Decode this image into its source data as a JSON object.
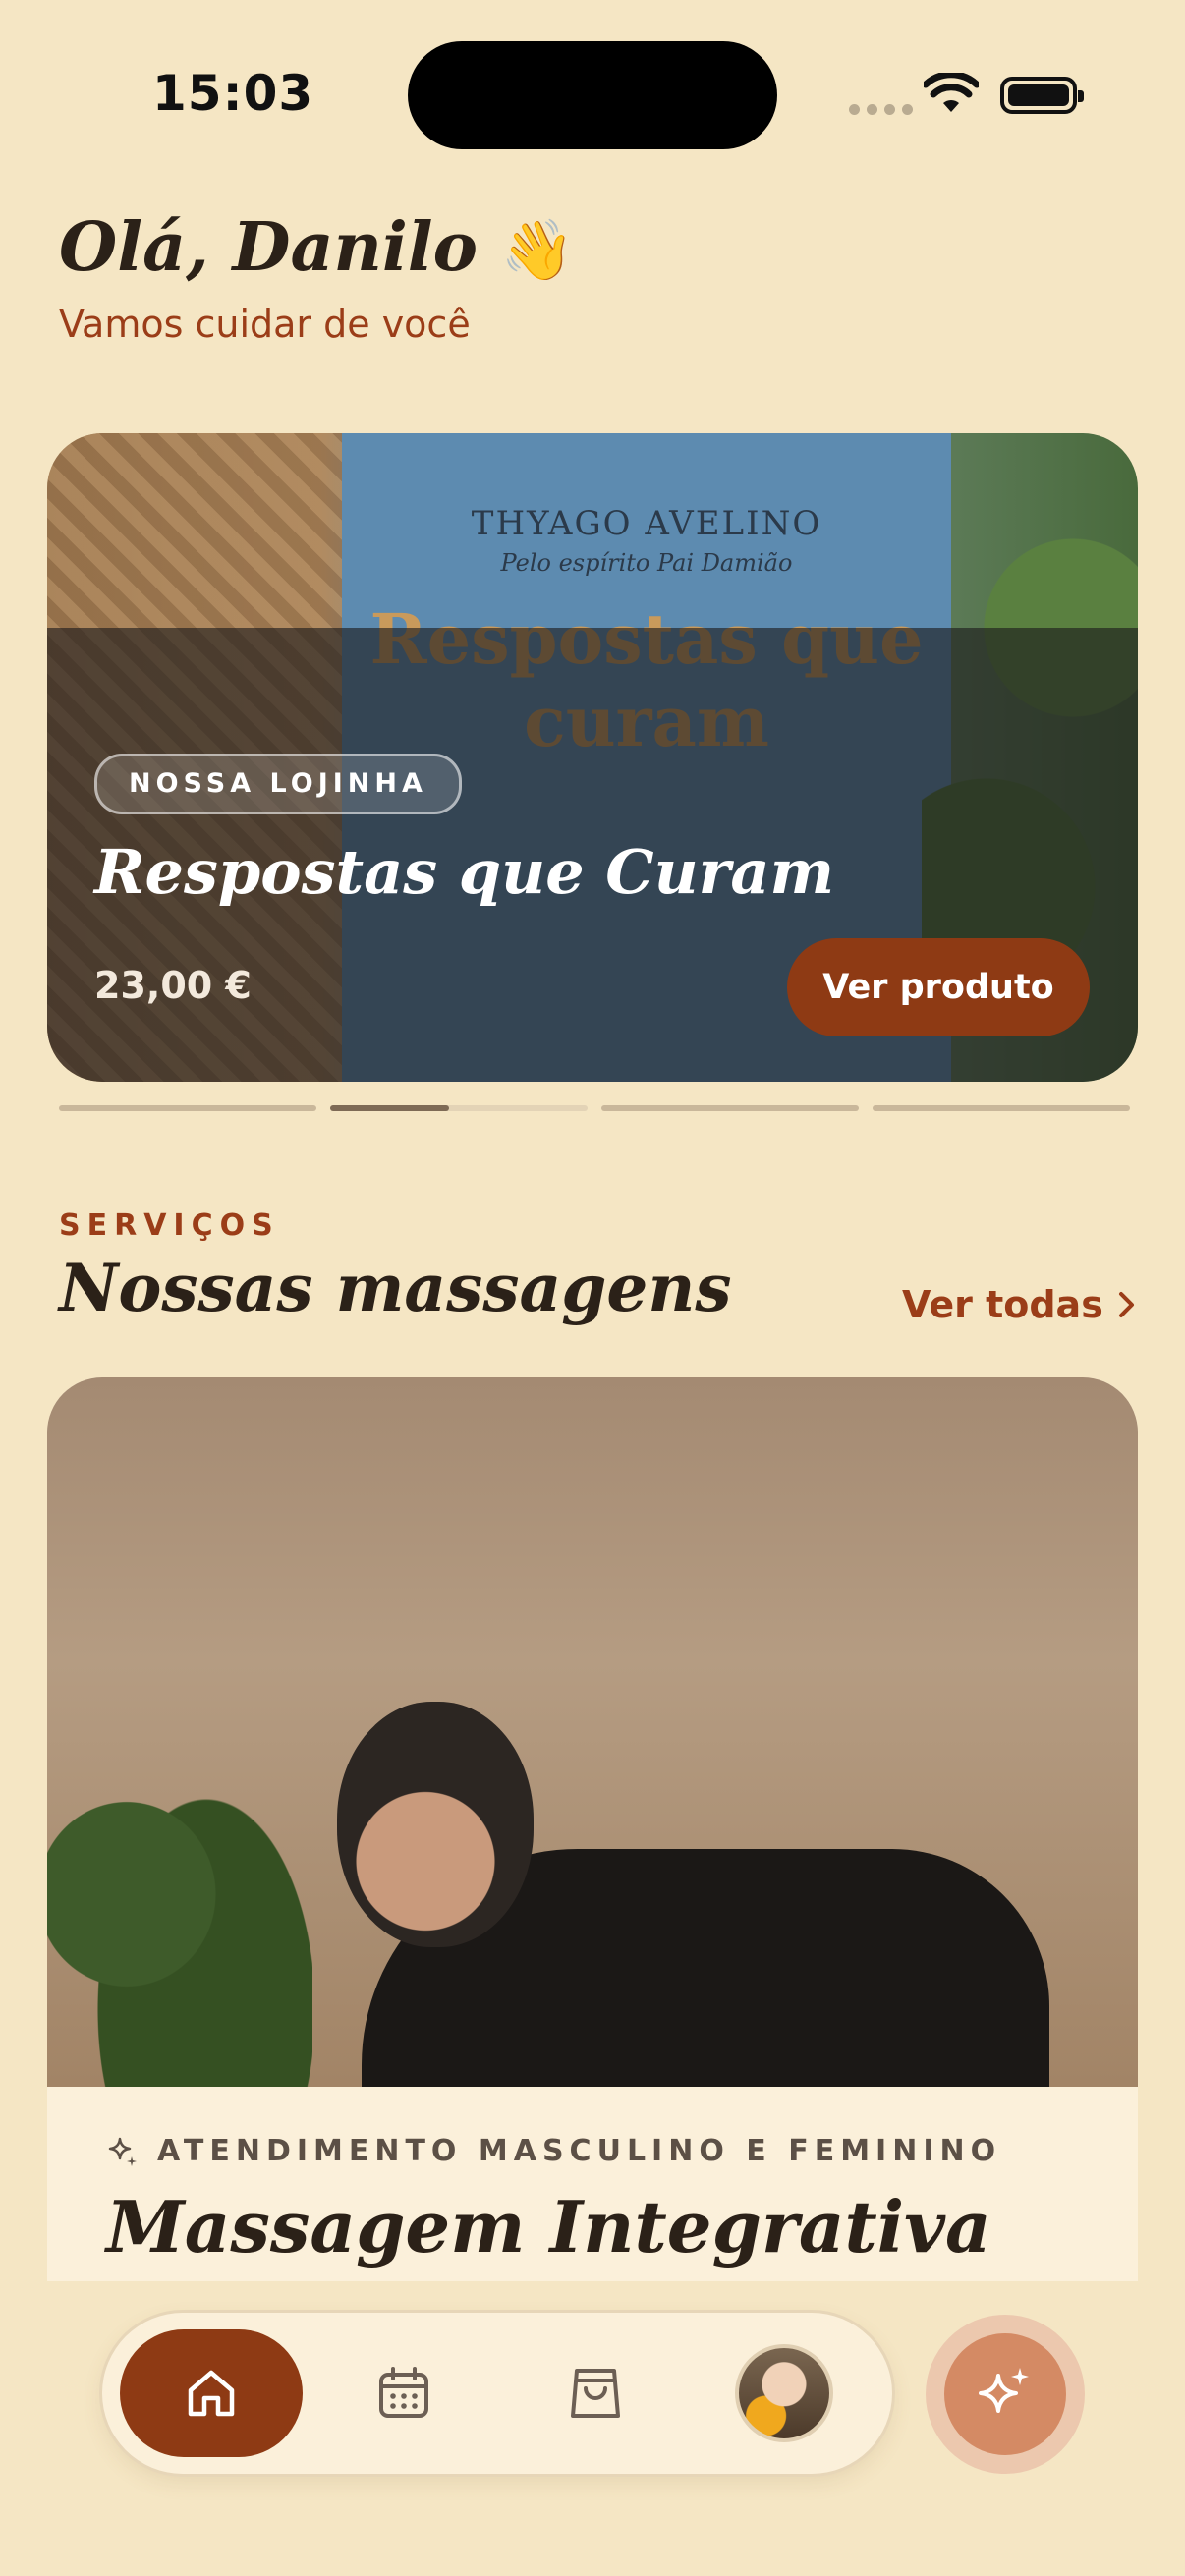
{
  "status_bar": {
    "time": "15:03"
  },
  "greeting": {
    "title": "Olá, Danilo",
    "emoji": "👋",
    "subtitle": "Vamos cuidar de você"
  },
  "hero": {
    "badge": "NOSSA LOJINHA",
    "title": "Respostas que Curam",
    "price": "23,00 €",
    "button_label": "Ver produto",
    "book_author": "THYAGO AVELINO",
    "book_subtitle": "Pelo espírito Pai Damião",
    "book_title": "Respostas que curam"
  },
  "carousel": {
    "pages": 4,
    "active": 1,
    "progress": 0.46
  },
  "section": {
    "kicker": "SERVIÇOS",
    "title": "Nossas massagens",
    "see_all": "Ver todas"
  },
  "service_card": {
    "tag": "ATENDIMENTO MASCULINO E FEMININO",
    "title": "Massagem Integrativa"
  },
  "nav": {
    "items": [
      {
        "icon": "home-icon",
        "active": true
      },
      {
        "icon": "calendar-icon",
        "active": false
      },
      {
        "icon": "shopping-bag-icon",
        "active": false
      },
      {
        "icon": "avatar",
        "active": false
      }
    ],
    "fab_icon": "sparkles-icon"
  },
  "colors": {
    "background": "#f5e6c4",
    "accent": "#8e3a14",
    "accent_text": "#9b3d18",
    "fab": "#d48a64"
  }
}
